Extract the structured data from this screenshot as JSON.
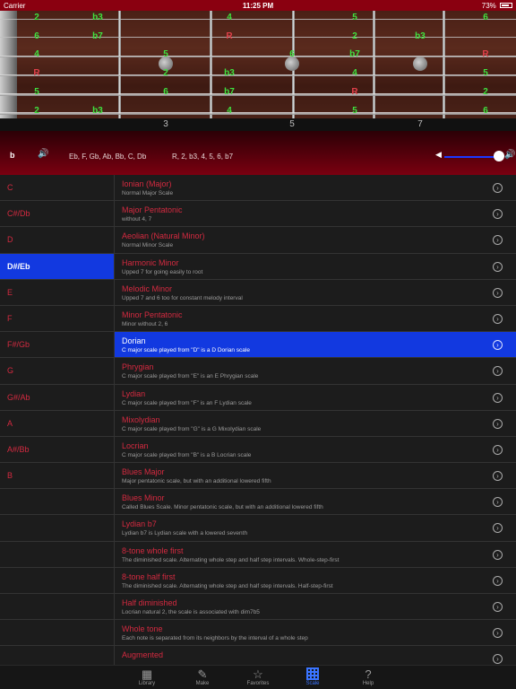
{
  "status_bar": {
    "carrier": "Carrier",
    "time": "11:25 PM",
    "battery": "73%",
    "battery_level": 0.73
  },
  "fretboard": {
    "fret_numbers": [
      "3",
      "5",
      "7"
    ],
    "rows": [
      [
        {
          "label": "2",
          "type": "interval"
        },
        {
          "label": "b3",
          "type": "interval"
        },
        {
          "label": "4",
          "type": "interval"
        },
        {
          "label": "5",
          "type": "interval"
        },
        {
          "label": "6",
          "type": "interval"
        }
      ],
      [
        {
          "label": "6",
          "type": "interval"
        },
        {
          "label": "b7",
          "type": "interval"
        },
        {
          "label": "R",
          "type": "root"
        },
        {
          "label": "2",
          "type": "interval"
        },
        {
          "label": "b3",
          "type": "interval"
        }
      ],
      [
        {
          "label": "4",
          "type": "interval"
        },
        {
          "label": "5",
          "type": "interval"
        },
        {
          "label": "6",
          "type": "interval"
        },
        {
          "label": "b7",
          "type": "interval"
        },
        {
          "label": "R",
          "type": "root"
        }
      ],
      [
        {
          "label": "R",
          "type": "root"
        },
        {
          "label": "2",
          "type": "interval"
        },
        {
          "label": "b3",
          "type": "interval"
        },
        {
          "label": "4",
          "type": "interval"
        },
        {
          "label": "5",
          "type": "interval"
        }
      ],
      [
        {
          "label": "5",
          "type": "interval"
        },
        {
          "label": "6",
          "type": "interval"
        },
        {
          "label": "b7",
          "type": "interval"
        },
        {
          "label": "R",
          "type": "root"
        },
        {
          "label": "2",
          "type": "interval"
        }
      ],
      [
        {
          "label": "2",
          "type": "interval"
        },
        {
          "label": "b3",
          "type": "interval"
        },
        {
          "label": "4",
          "type": "interval"
        },
        {
          "label": "5",
          "type": "interval"
        },
        {
          "label": "6",
          "type": "interval"
        }
      ]
    ]
  },
  "controls": {
    "mode": "b",
    "speaker_icon": "speaker-icon",
    "notes": "Eb, F, Gb, Ab, Bb, C, Db",
    "intervals": "R, 2, b3, 4, 5, 6, b7",
    "volume": 1.0
  },
  "keys": [
    "C",
    "C#/Db",
    "D",
    "D#/Eb",
    "E",
    "F",
    "F#/Gb",
    "G",
    "G#/Ab",
    "A",
    "A#/Bb",
    "B"
  ],
  "selected_key": "D#/Eb",
  "scales": [
    {
      "name": "Ionian (Major)",
      "desc": "Normal Major Scale"
    },
    {
      "name": "Major Pentatonic",
      "desc": "without 4, 7"
    },
    {
      "name": "Aeolian (Natural Minor)",
      "desc": "Normal Minor Scale"
    },
    {
      "name": "Harmonic Minor",
      "desc": "Upped 7 for going easily to root"
    },
    {
      "name": "Melodic Minor",
      "desc": "Upped 7 and 6 too for constant melody interval"
    },
    {
      "name": "Minor Pentatonic",
      "desc": "Minor without 2, 6"
    },
    {
      "name": "Dorian",
      "desc": "C major scale played from \"D\" is a D Dorian scale"
    },
    {
      "name": "Phrygian",
      "desc": "C major scale played from \"E\" is an E Phrygian scale"
    },
    {
      "name": "Lydian",
      "desc": "C major scale played from \"F\" is an F Lydian scale"
    },
    {
      "name": "Mixolydian",
      "desc": "C major scale played from \"G\" is a G Mixolydian scale"
    },
    {
      "name": "Locrian",
      "desc": "C major scale played from \"B\" is a B Locrian scale"
    },
    {
      "name": "Blues Major",
      "desc": "Major pentatonic scale, but with an additional lowered fifth"
    },
    {
      "name": "Blues Minor",
      "desc": "Called Blues Scale. Minor pentatonic scale, but with an additional lowered fifth"
    },
    {
      "name": "Lydian b7",
      "desc": "Lydian b7 is Lydian scale with a lowered seventh"
    },
    {
      "name": "8-tone whole first",
      "desc": "The diminished scale. Alternating whole step and half step intervals. Whole-step-first"
    },
    {
      "name": "8-tone half first",
      "desc": "The diminished scale. Alternating whole step and half step intervals. Half-step-first"
    },
    {
      "name": "Half diminished",
      "desc": "Locrian natural 2, the scale is associated with dim7b5"
    },
    {
      "name": "Whole tone",
      "desc": "Each note is separated from its neighbors by the interval of a whole step"
    },
    {
      "name": "Augmented",
      "desc": ""
    }
  ],
  "selected_scale": "Dorian",
  "tabs": [
    {
      "label": "Library",
      "icon": "library-icon"
    },
    {
      "label": "Make",
      "icon": "pencil-icon"
    },
    {
      "label": "Favorites",
      "icon": "star-icon"
    },
    {
      "label": "Scale",
      "icon": "grid-icon"
    },
    {
      "label": "Help",
      "icon": "question-icon"
    }
  ],
  "active_tab": "Scale",
  "colors": {
    "accent_blue": "#1239e0",
    "root_red": "#e0404a",
    "interval_green": "#3fe23f",
    "list_red": "#d42a40"
  }
}
